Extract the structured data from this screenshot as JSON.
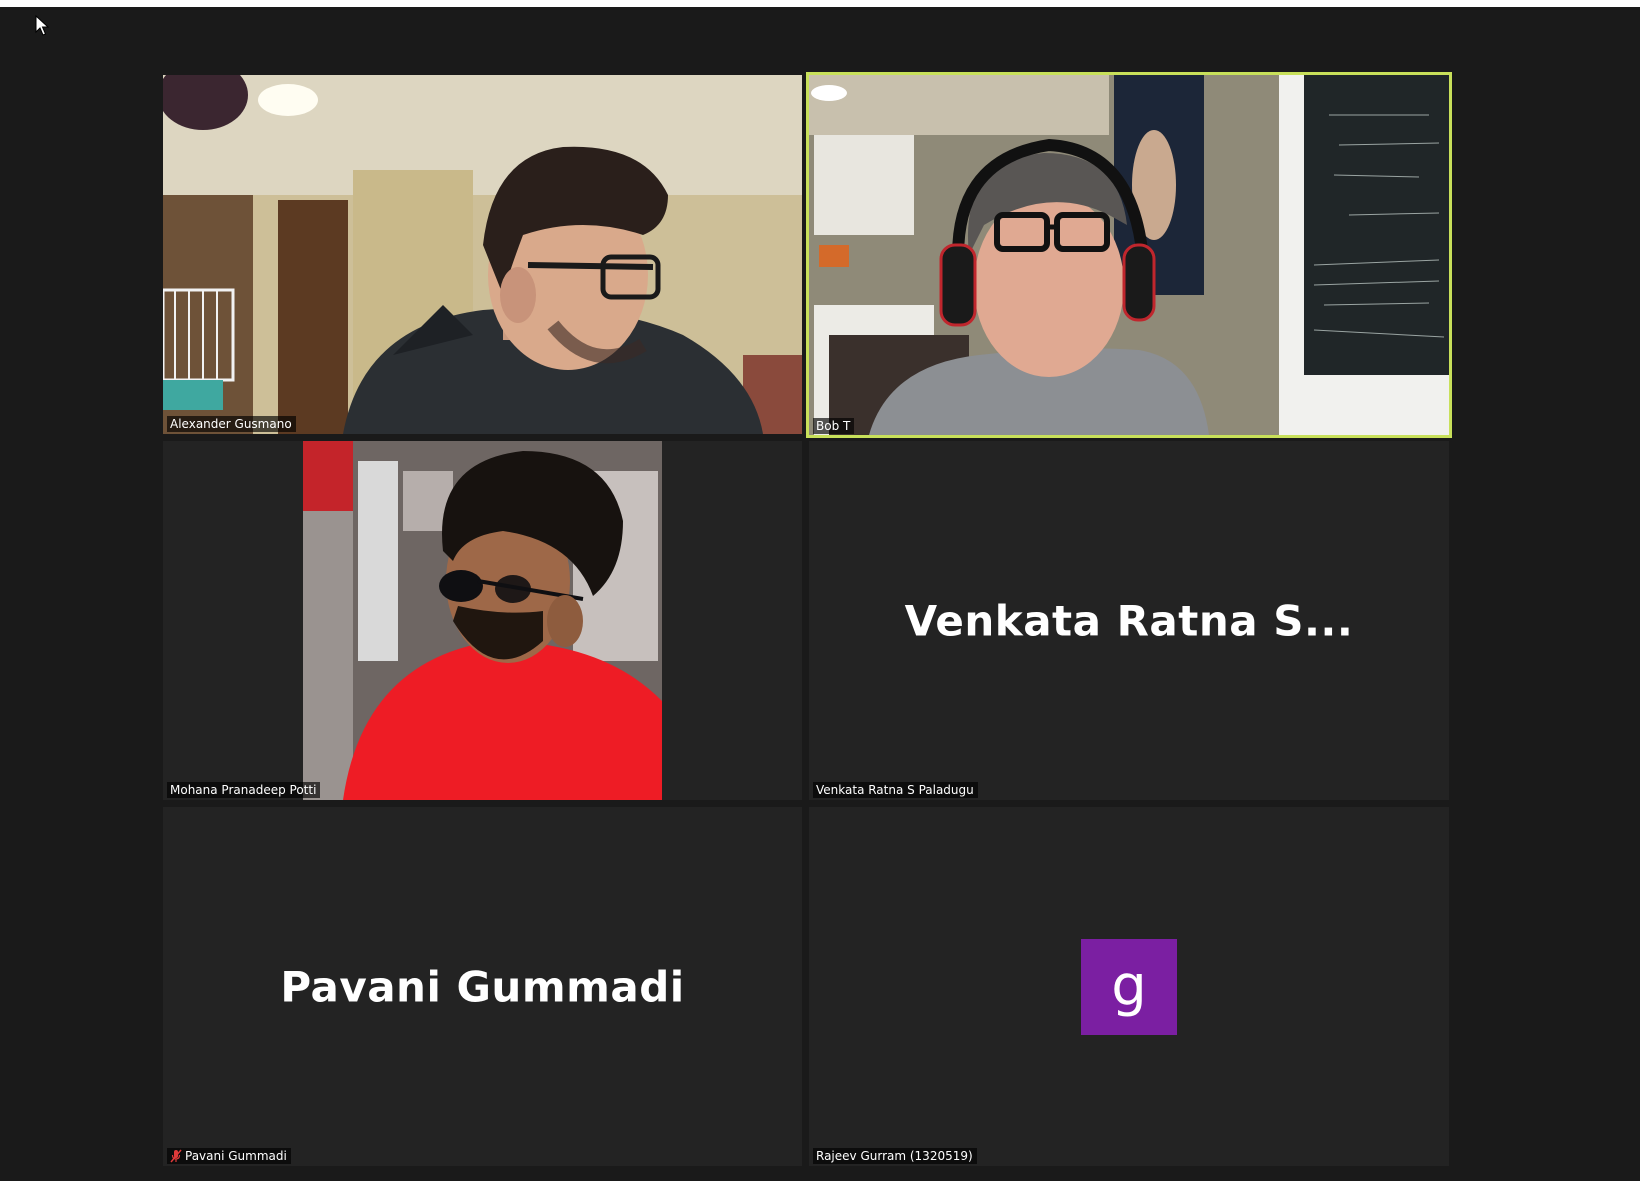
{
  "meeting": {
    "accent_color": "#c8e05a",
    "background_color": "#1a1a1a"
  },
  "participants": [
    {
      "name": "Alexander Gusmano",
      "video_on": true,
      "active_speaker": false,
      "muted": false
    },
    {
      "name": "Bob T",
      "video_on": true,
      "active_speaker": true,
      "muted": false
    },
    {
      "name": "Mohana Pranadeep Potti",
      "video_on": true,
      "active_speaker": false,
      "muted": false
    },
    {
      "name": "Venkata Ratna S Paladugu",
      "display_name_large": "Venkata Ratna S...",
      "video_on": false,
      "active_speaker": false,
      "muted": false
    },
    {
      "name": "Pavani Gummadi",
      "display_name_large": "Pavani Gummadi",
      "video_on": false,
      "active_speaker": false,
      "muted": true,
      "mic_icon": "mic-muted-icon"
    },
    {
      "name": "Rajeev Gurram (1320519)",
      "avatar_letter": "g",
      "avatar_color": "#7b1fa2",
      "video_on": false,
      "active_speaker": false,
      "muted": false
    }
  ]
}
